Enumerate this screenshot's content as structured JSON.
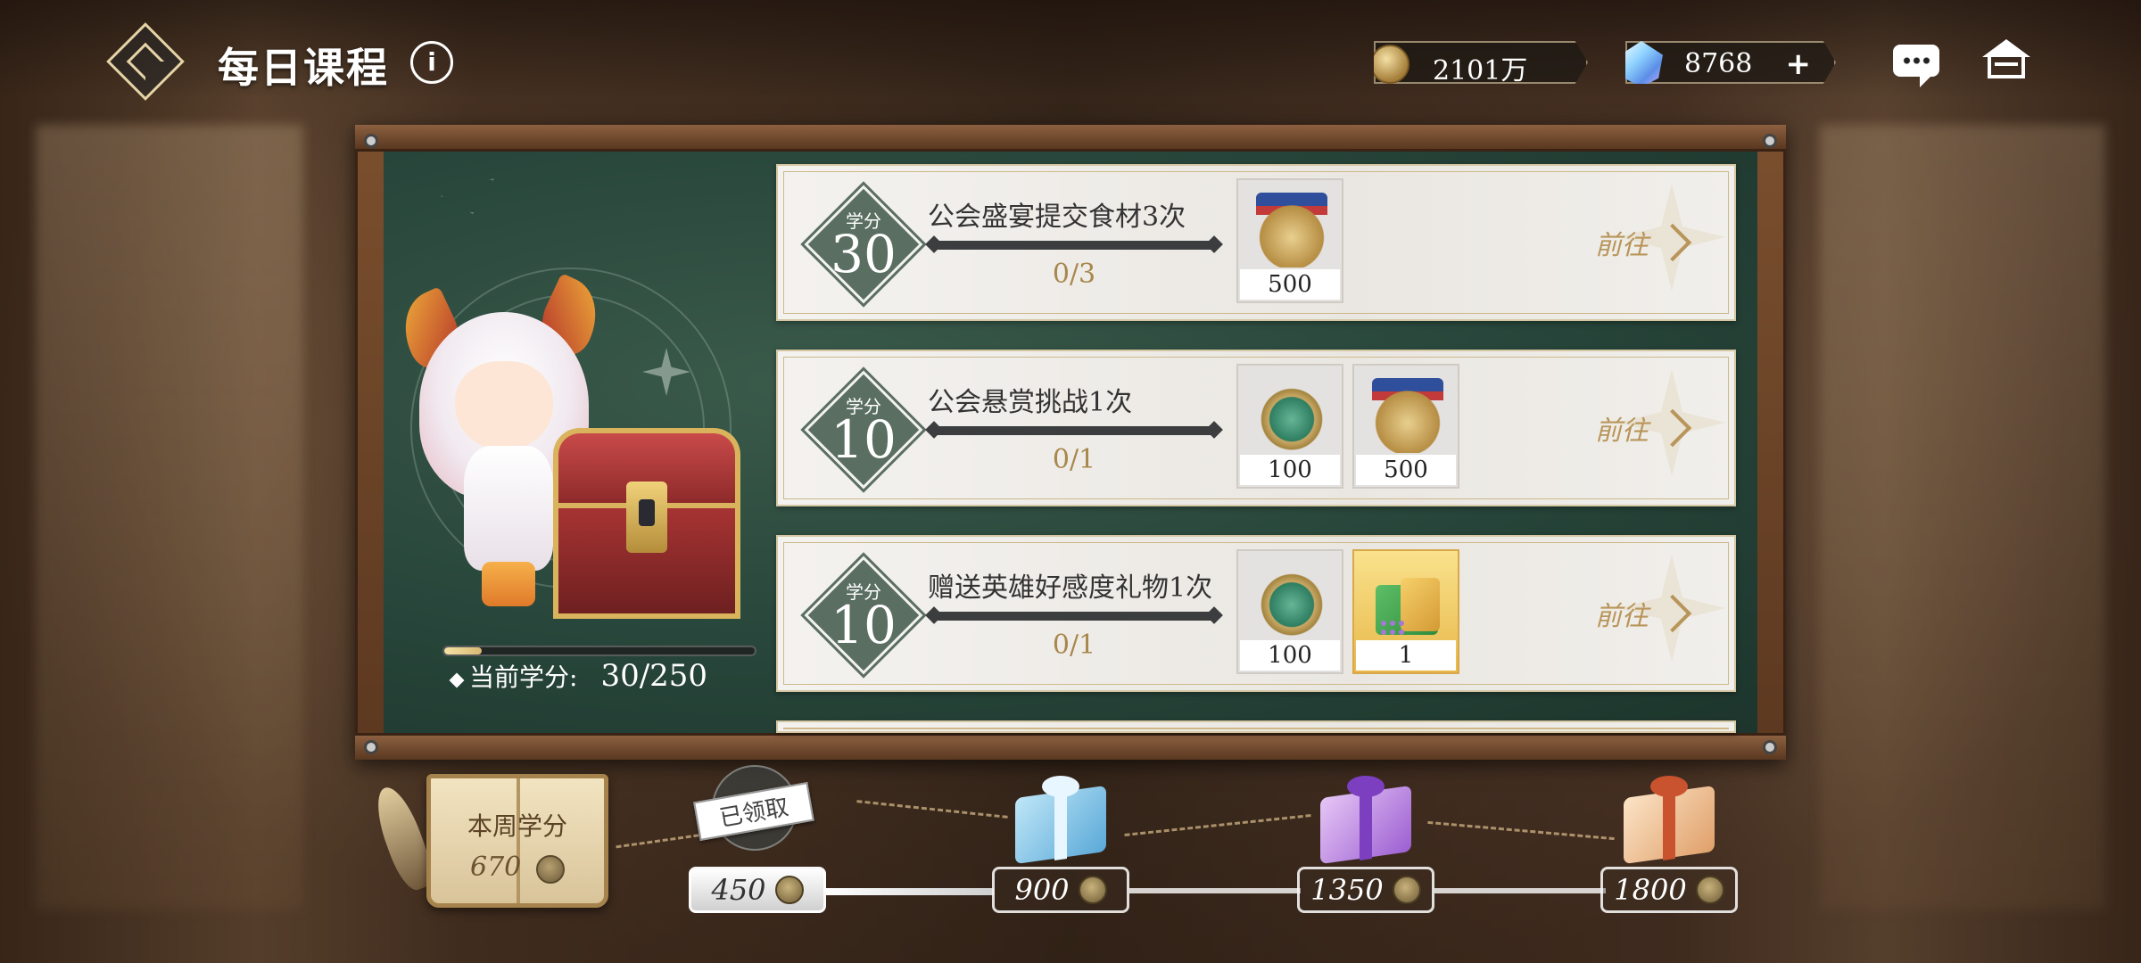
{
  "header": {
    "title": "每日课程",
    "info_icon": "info-icon",
    "gold_amount": "2101万",
    "gem_amount": "8768",
    "plus_label": "+"
  },
  "left_panel": {
    "current_credit_label": "当前学分:",
    "current_credit_value": "30/250",
    "progress": 0.12
  },
  "tasks": [
    {
      "credit_label": "学分",
      "credit_value": "30",
      "name": "公会盛宴提交食材3次",
      "progress": "0/3",
      "rewards": [
        {
          "icon": "guild-medal-gold-icon",
          "amount": "500"
        }
      ],
      "goto_label": "前往"
    },
    {
      "credit_label": "学分",
      "credit_value": "10",
      "name": "公会悬赏挑战1次",
      "progress": "0/1",
      "rewards": [
        {
          "icon": "emblem-green-icon",
          "amount": "100"
        },
        {
          "icon": "guild-medal-gold-icon",
          "amount": "500"
        }
      ],
      "goto_label": "前往"
    },
    {
      "credit_label": "学分",
      "credit_value": "10",
      "name": "赠送英雄好感度礼物1次",
      "progress": "0/1",
      "rewards": [
        {
          "icon": "emblem-green-icon",
          "amount": "100"
        },
        {
          "icon": "gift-basket-icon",
          "amount": "1"
        }
      ],
      "goto_label": "前往"
    }
  ],
  "weekly": {
    "label": "本周学分",
    "value": "670",
    "milestones": [
      {
        "value": "450",
        "status": "claimed",
        "claimed_label": "已领取"
      },
      {
        "value": "900",
        "status": "locked",
        "gift": "blue-gift-icon"
      },
      {
        "value": "1350",
        "status": "locked",
        "gift": "purple-gift-icon"
      },
      {
        "value": "1800",
        "status": "locked",
        "gift": "orange-gift-icon"
      }
    ]
  },
  "colors": {
    "accent_gold": "#b8955a",
    "board_green": "#27453a",
    "badge_green": "#5a6f62"
  }
}
